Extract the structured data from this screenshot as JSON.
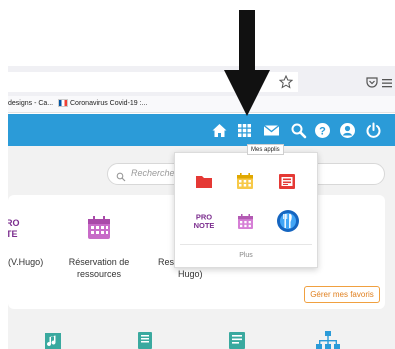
{
  "browser": {
    "bookmarks": [
      "designs - Ca...",
      "Coronavirus Covid-19 :..."
    ]
  },
  "header": {
    "icons": [
      "home-icon",
      "apps-grid-icon",
      "mail-icon",
      "search-icon",
      "help-icon",
      "account-icon",
      "power-icon"
    ],
    "color": "#2b9bd8",
    "tooltip": "Mes applis"
  },
  "search": {
    "placeholder": "Recherche"
  },
  "favorites": {
    "tiles": [
      {
        "label": "(V.Hugo)",
        "icon": "pronote-icon"
      },
      {
        "label": "Réservation de ressources",
        "icon": "calendar-icon"
      },
      {
        "label": "Res",
        "icon": "app-icon"
      },
      {
        "label": "Hugo)",
        "icon": "app-icon"
      }
    ],
    "manage_label": "Gérer mes favoris",
    "accent": "#e08020"
  },
  "apps_menu": {
    "icons": [
      "folder-icon",
      "calendar-icon",
      "schedule-icon",
      "pronote-icon",
      "calendar-icon",
      "restaurant-icon"
    ],
    "more_label": "Plus"
  },
  "bottom_icons": [
    "music-file-icon",
    "notebook-icon",
    "document-icon",
    "sitemap-icon"
  ]
}
